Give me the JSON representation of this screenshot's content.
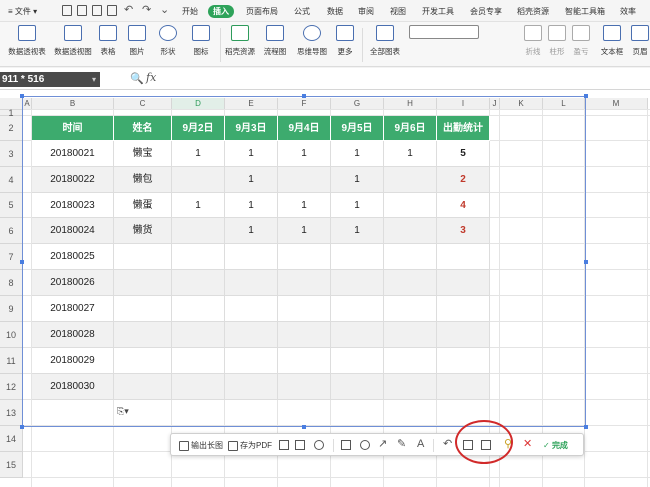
{
  "menu": {
    "file": "文件",
    "tabs": [
      "开始",
      "插入",
      "页面布局",
      "公式",
      "数据",
      "审阅",
      "视图",
      "开发工具",
      "会员专享",
      "稻壳资源",
      "智能工具箱",
      "效率"
    ],
    "active_tab": "插入"
  },
  "ribbon": {
    "buttons": [
      {
        "label": "数据透视表"
      },
      {
        "label": "数据透视图"
      },
      {
        "label": "表格"
      },
      {
        "label": "图片"
      },
      {
        "label": "形状"
      },
      {
        "label": "图标"
      },
      {
        "label": "稻壳资源"
      },
      {
        "label": "流程图"
      },
      {
        "label": "思维导图"
      },
      {
        "label": "更多"
      },
      {
        "label": "全部图表"
      },
      {
        "label": "折线"
      },
      {
        "label": "柱形"
      },
      {
        "label": "盈亏"
      },
      {
        "label": "文本框"
      },
      {
        "label": "页眉"
      }
    ]
  },
  "formula_bar": {
    "name_box": "911 * 516",
    "fx": "fx"
  },
  "columns": [
    "A",
    "B",
    "C",
    "D",
    "E",
    "F",
    "G",
    "H",
    "I",
    "J",
    "K",
    "L",
    "M"
  ],
  "rows": [
    "1",
    "2",
    "3",
    "4",
    "5",
    "6",
    "7",
    "8",
    "9",
    "10",
    "11",
    "12",
    "13",
    "14",
    "15"
  ],
  "table": {
    "headers": [
      "时间",
      "姓名",
      "9月2日",
      "9月3日",
      "9月4日",
      "9月5日",
      "9月6日",
      "出勤统计"
    ],
    "rows": [
      [
        "20180021",
        "懒宝",
        "1",
        "1",
        "1",
        "1",
        "1",
        "5"
      ],
      [
        "20180022",
        "懒包",
        "",
        "1",
        "",
        "1",
        "",
        "2"
      ],
      [
        "20180023",
        "懒蛋",
        "1",
        "1",
        "1",
        "1",
        "",
        "4"
      ],
      [
        "20180024",
        "懒货",
        "",
        "1",
        "1",
        "1",
        "",
        "3"
      ],
      [
        "20180025",
        "",
        "",
        "",
        "",
        "",
        "",
        ""
      ],
      [
        "20180026",
        "",
        "",
        "",
        "",
        "",
        "",
        ""
      ],
      [
        "20180027",
        "",
        "",
        "",
        "",
        "",
        "",
        ""
      ],
      [
        "20180028",
        "",
        "",
        "",
        "",
        "",
        "",
        ""
      ],
      [
        "20180029",
        "",
        "",
        "",
        "",
        "",
        "",
        ""
      ],
      [
        "20180030",
        "",
        "",
        "",
        "",
        "",
        "",
        ""
      ]
    ]
  },
  "paste_icon": "⎘▾",
  "screenshot_toolbar": {
    "export_long": "输出长图",
    "save_pdf": "存为PDF",
    "done": "完成"
  }
}
